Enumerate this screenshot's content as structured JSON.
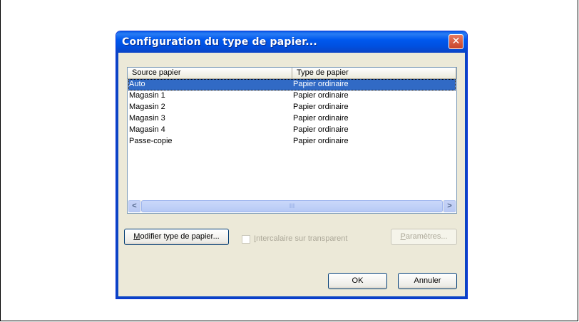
{
  "dialog": {
    "title": "Configuration du type de papier...",
    "close_label": "✕"
  },
  "list": {
    "columns": [
      "Source papier",
      "Type de papier"
    ],
    "rows": [
      {
        "source": "Auto",
        "type": "Papier ordinaire",
        "selected": true
      },
      {
        "source": "Magasin 1",
        "type": "Papier ordinaire"
      },
      {
        "source": "Magasin 2",
        "type": "Papier ordinaire"
      },
      {
        "source": "Magasin 3",
        "type": "Papier ordinaire"
      },
      {
        "source": "Magasin 4",
        "type": "Papier ordinaire"
      },
      {
        "source": "Passe-copie",
        "type": "Papier ordinaire"
      }
    ],
    "scroll_left": "<",
    "scroll_right": ">",
    "thumb_grip": "III"
  },
  "buttons": {
    "modify_first": "M",
    "modify_rest": "odifier type de papier...",
    "params_first": "P",
    "params_rest": "aramètres...",
    "ok": "OK",
    "cancel": "Annuler"
  },
  "checkbox": {
    "label_first": "I",
    "label_rest": "ntercalaire sur transparent",
    "checked": false,
    "enabled": false
  }
}
